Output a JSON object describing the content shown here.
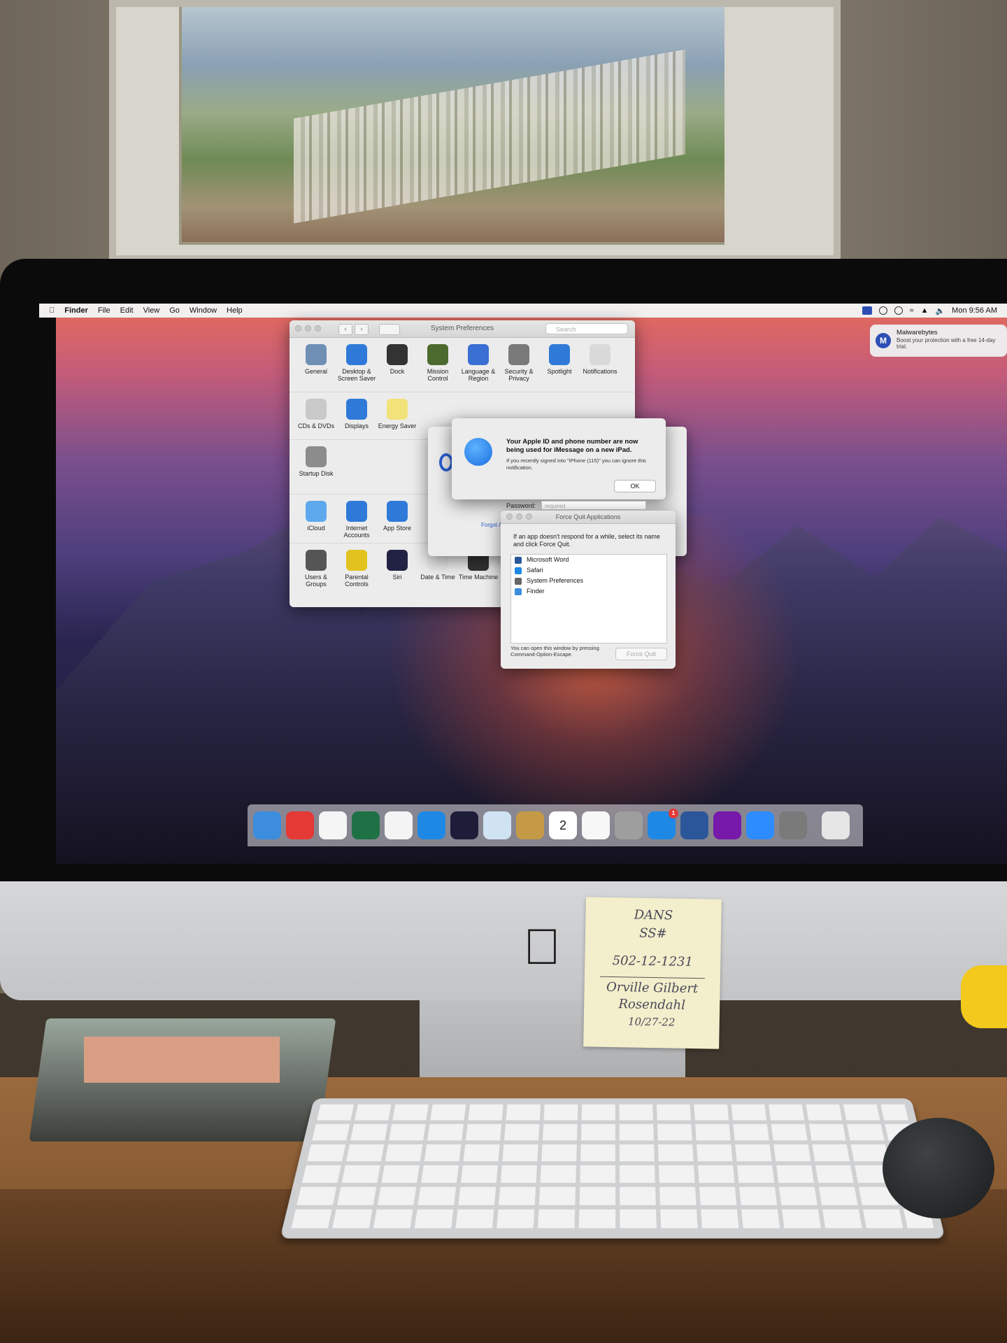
{
  "menubar": {
    "app": "Finder",
    "menus": [
      "File",
      "Edit",
      "View",
      "Go",
      "Window",
      "Help"
    ],
    "clock": "Mon 9:56 AM"
  },
  "notification": {
    "app": "Malwarebytes",
    "message": "Boost your protection with a free 14-day trial.",
    "icon_letter": "M"
  },
  "system_preferences": {
    "title": "System Preferences",
    "search_placeholder": "Search",
    "rows": [
      [
        {
          "label": "General",
          "icon": "general-icon",
          "color": "#6f8fb5"
        },
        {
          "label": "Desktop & Screen Saver",
          "icon": "desktop-icon",
          "color": "#2f7ad8"
        },
        {
          "label": "Dock",
          "icon": "dock-icon",
          "color": "#333333"
        },
        {
          "label": "Mission Control",
          "icon": "mission-control-icon",
          "color": "#4c6a2e"
        },
        {
          "label": "Language & Region",
          "icon": "language-icon",
          "color": "#3a6fd3"
        },
        {
          "label": "Security & Privacy",
          "icon": "security-icon",
          "color": "#7a7a7a"
        },
        {
          "label": "Spotlight",
          "icon": "spotlight-icon",
          "color": "#2f7ad8"
        },
        {
          "label": "Notifications",
          "icon": "notifications-icon",
          "color": "#d9d9d9"
        }
      ],
      [
        {
          "label": "CDs & DVDs",
          "icon": "cd-icon",
          "color": "#c9c9c9"
        },
        {
          "label": "Displays",
          "icon": "displays-icon",
          "color": "#2f7ad8"
        },
        {
          "label": "Energy Saver",
          "icon": "energy-icon",
          "color": "#f2e27a"
        }
      ],
      [
        {
          "label": "Startup Disk",
          "icon": "startup-disk-icon",
          "color": "#8c8c8c"
        }
      ],
      [
        {
          "label": "iCloud",
          "icon": "icloud-icon",
          "color": "#5ea9ee"
        },
        {
          "label": "Internet Accounts",
          "icon": "internet-accounts-icon",
          "color": "#2f7ad8"
        },
        {
          "label": "App Store",
          "icon": "app-store-icon",
          "color": "#2f7ad8"
        }
      ],
      [
        {
          "label": "Users & Groups",
          "icon": "users-icon",
          "color": "#555555"
        },
        {
          "label": "Parental Controls",
          "icon": "parental-icon",
          "color": "#e2c21f"
        },
        {
          "label": "Siri",
          "icon": "siri-icon",
          "color": "#222244"
        },
        {
          "label": "Date & Time",
          "icon": "date-time-icon",
          "color": "#e7e7e7"
        },
        {
          "label": "Time Machine",
          "icon": "time-machine-icon",
          "color": "#333333"
        }
      ]
    ]
  },
  "imessage_alert": {
    "title": "Your Apple ID and phone number are now being used for iMessage on a new iPad.",
    "body": "If you recently signed into \"iPhone (115)\" you can ignore this notification.",
    "ok_label": "OK"
  },
  "password_prompt": {
    "label": "Password:",
    "placeholder": "required",
    "forgot": "Forgot A"
  },
  "force_quit": {
    "title": "Force Quit Applications",
    "description": "If an app doesn't respond for a while, select its name and click Force Quit.",
    "apps": [
      {
        "name": "Microsoft Word",
        "color": "#2b579a"
      },
      {
        "name": "Safari",
        "color": "#1e88e5"
      },
      {
        "name": "System Preferences",
        "color": "#666666"
      },
      {
        "name": "Finder",
        "color": "#3c8dde"
      }
    ],
    "footer": "You can open this window by pressing Command-Option-Escape.",
    "button": "Force Quit"
  },
  "dock": {
    "apps": [
      {
        "name": "finder-icon",
        "color": "#3c8dde"
      },
      {
        "name": "mail-icon",
        "color": "#e53935"
      },
      {
        "name": "music-icon",
        "color": "#f5f5f5"
      },
      {
        "name": "excel-icon",
        "color": "#1e7145"
      },
      {
        "name": "chrome-icon",
        "color": "#f4f4f4"
      },
      {
        "name": "safari-icon",
        "color": "#1e88e5"
      },
      {
        "name": "siri-icon",
        "color": "#1d1d3a"
      },
      {
        "name": "preview-icon",
        "color": "#cfe3f3"
      },
      {
        "name": "notes-icon",
        "color": "#c59a46"
      },
      {
        "name": "calendar-icon",
        "color": "#ffffff",
        "text": "2"
      },
      {
        "name": "photos-icon",
        "color": "#f7f7f7"
      },
      {
        "name": "calculator-icon",
        "color": "#9e9e9e"
      },
      {
        "name": "app-store-icon",
        "color": "#1e88e5",
        "badge": "1"
      },
      {
        "name": "word-icon",
        "color": "#2b579a"
      },
      {
        "name": "onenote-icon",
        "color": "#7719aa"
      },
      {
        "name": "zoom-icon",
        "color": "#2d8cff"
      },
      {
        "name": "system-preferences-icon",
        "color": "#7a7a7a"
      },
      {
        "name": "trash-icon",
        "color": "#e6e6e6"
      }
    ]
  },
  "sticky_note": {
    "lines": [
      "DANS",
      "SS#",
      "502-12-1231",
      "Orville Gilbert",
      "Rosendahl",
      "10/27-22"
    ]
  }
}
